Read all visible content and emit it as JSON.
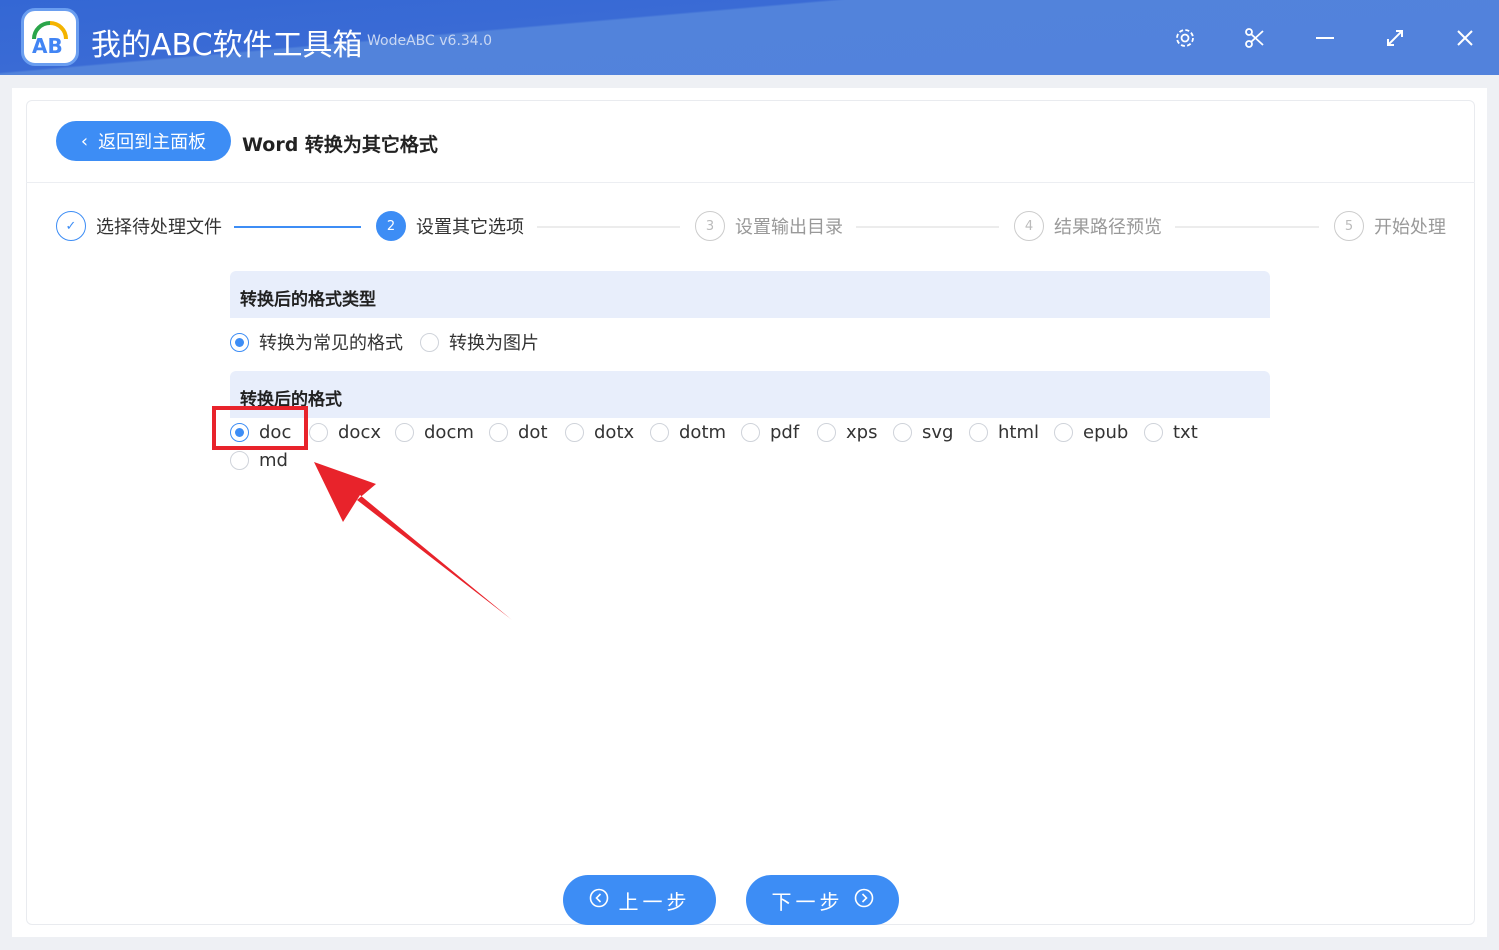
{
  "app": {
    "title": "我的ABC软件工具箱",
    "version": "WodeABC v6.34.0",
    "logo_text": "AB"
  },
  "header": {
    "back_label": "返回到主面板",
    "page_title": "Word 转换为其它格式"
  },
  "steps": [
    {
      "num": "✓",
      "label": "选择待处理文件"
    },
    {
      "num": "2",
      "label": "设置其它选项"
    },
    {
      "num": "3",
      "label": "设置输出目录"
    },
    {
      "num": "4",
      "label": "结果路径预览"
    },
    {
      "num": "5",
      "label": "开始处理"
    }
  ],
  "section1": {
    "title": "转换后的格式类型",
    "options": [
      "转换为常见的格式",
      "转换为图片"
    ],
    "selected": "转换为常见的格式"
  },
  "section2": {
    "title": "转换后的格式",
    "options": [
      "doc",
      "docx",
      "docm",
      "dot",
      "dotx",
      "dotm",
      "pdf",
      "xps",
      "svg",
      "html",
      "epub",
      "txt",
      "md"
    ],
    "selected": "doc"
  },
  "footer": {
    "prev_label": "上一步",
    "next_label": "下一步"
  },
  "colors": {
    "accent": "#3d8df5",
    "highlight": "#e8232b"
  }
}
